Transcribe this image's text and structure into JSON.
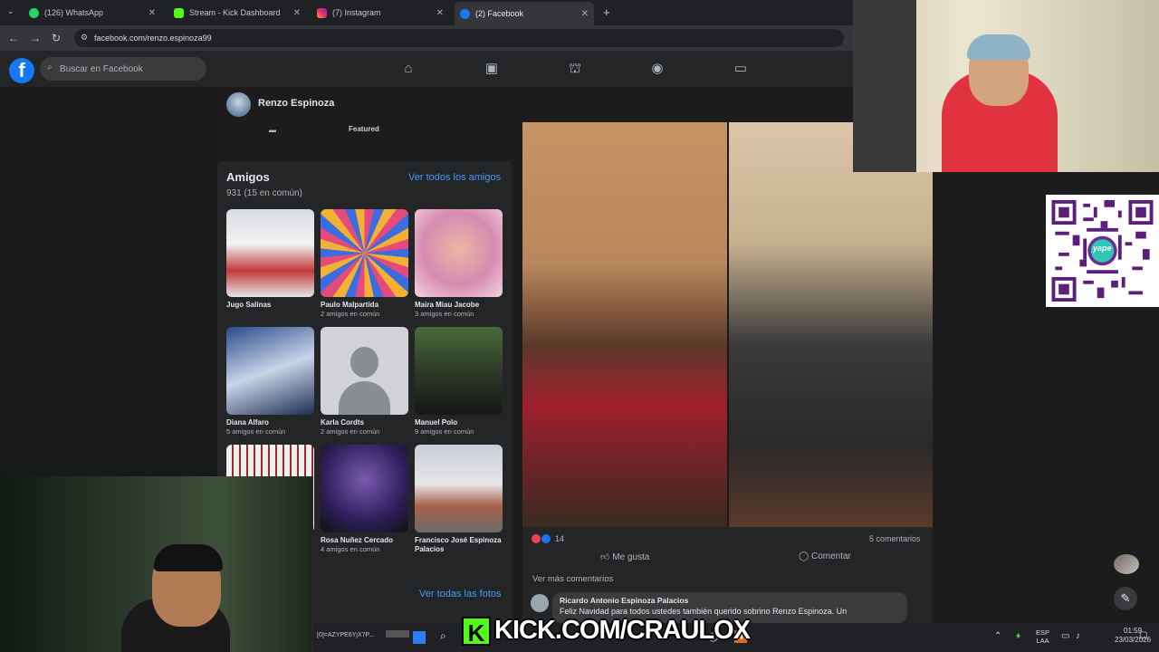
{
  "browser": {
    "tabs": [
      {
        "label": "(126) WhatsApp",
        "color": "#25d366"
      },
      {
        "label": "Stream - Kick Dashboard",
        "color": "#53fc18"
      },
      {
        "label": "(7) Instagram",
        "color": "#e1306c"
      },
      {
        "label": "(2) Facebook",
        "color": "#1877f2"
      }
    ],
    "active_tab": 3,
    "url": "facebook.com/renzo.espinoza99"
  },
  "facebook": {
    "logo": "f",
    "search_placeholder": "Buscar en Facebook",
    "nav_icons": [
      "home-icon",
      "video-icon",
      "marketplace-icon",
      "groups-icon",
      "gaming-icon"
    ],
    "profile": {
      "name": "Renzo Espinoza",
      "featured_label": "Featured"
    },
    "friends": {
      "title": "Amigos",
      "count": "931 (15 en común)",
      "see_all": "Ver todos los amigos",
      "list": [
        {
          "name": "Jugo Salinas",
          "mutual": ""
        },
        {
          "name": "Paulo Malpartida",
          "mutual": "2 amigos en común"
        },
        {
          "name": "Maira Miau Jacobe",
          "mutual": "3 amigos en común"
        },
        {
          "name": "Diana Alfaro",
          "mutual": "5 amigos en común"
        },
        {
          "name": "Karla Cordts",
          "mutual": "2 amigos en común"
        },
        {
          "name": "Manuel Polo",
          "mutual": "9 amigos en común"
        },
        {
          "name": "",
          "mutual": ""
        },
        {
          "name": "Rosa Nuñez Cercado",
          "mutual": "4 amigos en común"
        },
        {
          "name": "Francisco José Espinoza Palacios",
          "mutual": ""
        }
      ],
      "see_all_photos": "Ver todas las fotos"
    },
    "post": {
      "reactions": "14",
      "comments": "5 comentarios",
      "like_label": "Me gusta",
      "comment_label": "Comentar",
      "more_comments": "Ver más comentarios",
      "comment_author": "Ricardo Antonio Espinoza Palacios",
      "comment_text": "Feliz Navidad para todos ustedes también querido sobrino Renzo Espinoza. Un"
    }
  },
  "stream": {
    "banner": "KICK.COM/CRAULOX",
    "banner_k": "K",
    "qr_label": "yape"
  },
  "taskbar": {
    "lang": "ESP",
    "lang_sub": "LAA",
    "time": "01:59",
    "date": "23/03/2026",
    "clipboard": "[0]=AZYPE6YjX7P..."
  }
}
